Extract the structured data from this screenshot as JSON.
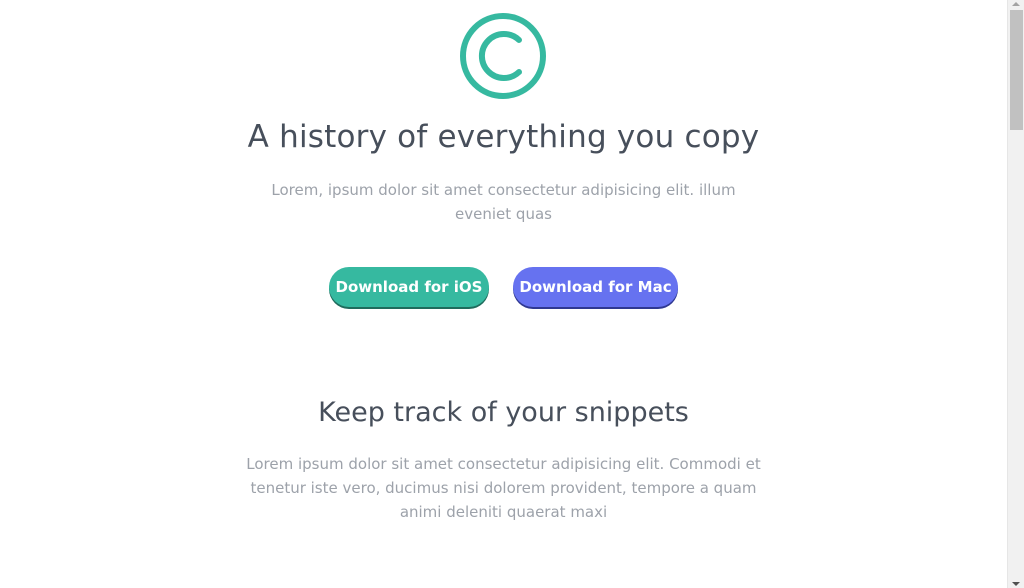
{
  "hero": {
    "logo_icon": "copyright-icon",
    "title": "A history of everything you copy",
    "subtitle": "Lorem, ipsum dolor sit amet consectetur adipisicing elit. illum eveniet quas",
    "buttons": {
      "ios_label": "Download for iOS",
      "mac_label": "Download for Mac"
    }
  },
  "features": {
    "title": "Keep track of your snippets",
    "text": "Lorem ipsum dolor sit amet consectetur adipisicing elit. Commodi et tenetur iste vero, ducimus nisi dolorem provident, tempore a quam animi deleniti quaerat maxi"
  },
  "colors": {
    "accent_teal": "#36b9a0",
    "accent_indigo": "#6672f0",
    "heading": "#474f5b",
    "body_text": "#9da2aa"
  }
}
